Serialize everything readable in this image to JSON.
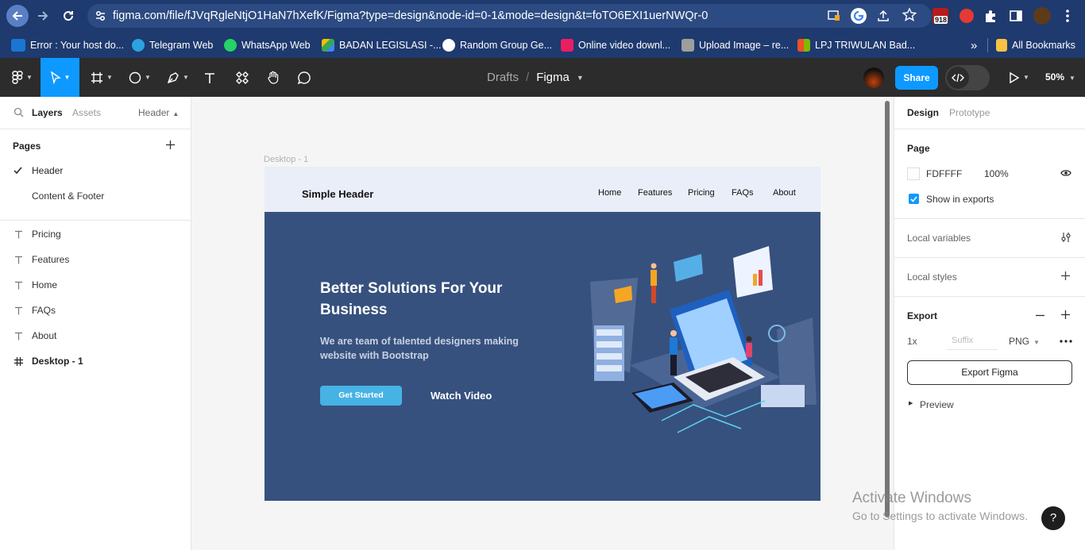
{
  "browser": {
    "url": "figma.com/file/fJVqRgleNtjO1HaN7hXefK/Figma?type=design&node-id=0-1&mode=design&t=foTO6EXI1uerNWQr-0",
    "bookmarks": [
      {
        "label": "Error : Your host do...",
        "icon": "vmw-icon",
        "color": "#1976d2"
      },
      {
        "label": "Telegram Web",
        "icon": "telegram-icon",
        "color": "#2aa3df"
      },
      {
        "label": "WhatsApp Web",
        "icon": "whatsapp-icon",
        "color": "#25d366"
      },
      {
        "label": "BADAN LEGISLASI -...",
        "icon": "drive-icon",
        "color": "#fbbc04"
      },
      {
        "label": "Random Group Ge...",
        "icon": "panda-icon",
        "color": "#ffffff"
      },
      {
        "label": "Online video downl...",
        "icon": "video-download-icon",
        "color": "#e91e63"
      },
      {
        "label": "Upload Image – re...",
        "icon": "upload-icon",
        "color": "#9e9e9e"
      },
      {
        "label": "LPJ TRIWULAN Bad...",
        "icon": "microsoft-icon",
        "color": "#f25022"
      }
    ],
    "more_bookmarks": "»",
    "all_bookmarks": "All Bookmarks",
    "badge_count": "918"
  },
  "figma_toolbar": {
    "breadcrumb_parent": "Drafts",
    "breadcrumb_sep": "/",
    "file_name": "Figma",
    "share_label": "Share",
    "zoom": "50%"
  },
  "left_panel": {
    "tab_layers": "Layers",
    "tab_assets": "Assets",
    "current_page": "Header",
    "pages_title": "Pages",
    "pages": [
      "Header",
      "Content & Footer"
    ],
    "layers": [
      {
        "label": "Pricing",
        "type": "text"
      },
      {
        "label": "Features",
        "type": "text"
      },
      {
        "label": "Home",
        "type": "text"
      },
      {
        "label": "FAQs",
        "type": "text"
      },
      {
        "label": "About",
        "type": "text"
      },
      {
        "label": "Desktop - 1",
        "type": "frame"
      }
    ]
  },
  "canvas": {
    "frame_label": "Desktop - 1",
    "site": {
      "brand": "Simple Header",
      "nav": [
        "Home",
        "Features",
        "Pricing",
        "FAQs",
        "About"
      ],
      "hero_title": "Better Solutions For Your Business",
      "hero_subtitle": "We are team of talented designers making website with Bootstrap",
      "cta_primary": "Get Started",
      "cta_secondary": "Watch Video",
      "colors": {
        "header_bg": "#e9eef8",
        "hero_bg": "#37517e",
        "button": "#47b2e4"
      }
    }
  },
  "right_panel": {
    "tab_design": "Design",
    "tab_prototype": "Prototype",
    "page_section": "Page",
    "page_color": "FDFFFF",
    "page_opacity": "100%",
    "show_in_exports": "Show in exports",
    "local_variables": "Local variables",
    "local_styles": "Local styles",
    "export_title": "Export",
    "export_scale": "1x",
    "export_suffix_placeholder": "Suffix",
    "export_format": "PNG",
    "export_button": "Export Figma",
    "preview": "Preview"
  },
  "watermark": {
    "title": "Activate Windows",
    "subtitle": "Go to Settings to activate Windows."
  },
  "help_label": "?"
}
